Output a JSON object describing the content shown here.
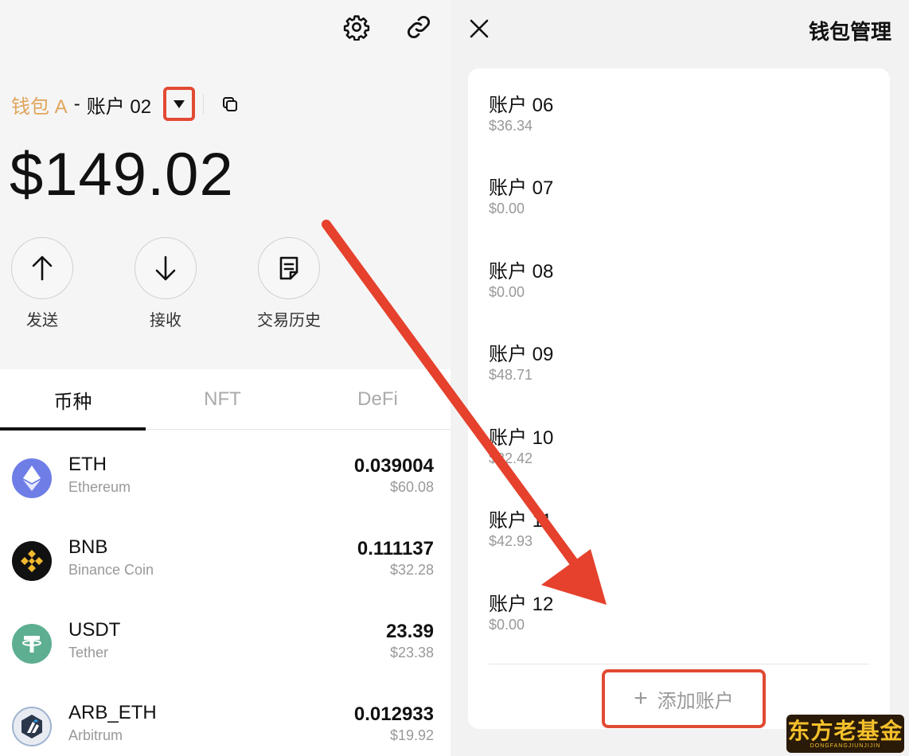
{
  "left": {
    "wallet_name": "钱包 A",
    "separator": "-",
    "account_name": "账户 02",
    "balance": "$149.02",
    "actions": [
      {
        "label": "发送",
        "icon": "arrow-up-icon"
      },
      {
        "label": "接收",
        "icon": "arrow-down-icon"
      },
      {
        "label": "交易历史",
        "icon": "history-icon"
      }
    ],
    "tabs": [
      {
        "label": "币种",
        "active": true
      },
      {
        "label": "NFT",
        "active": false
      },
      {
        "label": "DeFi",
        "active": false
      }
    ],
    "tokens": [
      {
        "symbol": "ETH",
        "name": "Ethereum",
        "amount": "0.039004",
        "usd": "$60.08",
        "icon": "ethereum-icon",
        "color": "#6f7ee6"
      },
      {
        "symbol": "BNB",
        "name": "Binance Coin",
        "amount": "0.111137",
        "usd": "$32.28",
        "icon": "bnb-icon",
        "color": "#111111"
      },
      {
        "symbol": "USDT",
        "name": "Tether",
        "amount": "23.39",
        "usd": "$23.38",
        "icon": "tether-icon",
        "color": "#5eaf91"
      },
      {
        "symbol": "ARB_ETH",
        "name": "Arbitrum",
        "amount": "0.012933",
        "usd": "$19.92",
        "icon": "arbitrum-icon",
        "color": "#2c374b"
      }
    ]
  },
  "right": {
    "title": "钱包管理",
    "accounts": [
      {
        "name": "账户 06",
        "balance": "$36.34"
      },
      {
        "name": "账户 07",
        "balance": "$0.00"
      },
      {
        "name": "账户 08",
        "balance": "$0.00"
      },
      {
        "name": "账户 09",
        "balance": "$48.71"
      },
      {
        "name": "账户 10",
        "balance": "$22.42"
      },
      {
        "name": "账户 11",
        "balance": "$42.93"
      },
      {
        "name": "账户 12",
        "balance": "$0.00"
      }
    ],
    "add_account_label": "添加账户"
  },
  "watermark": {
    "main": "东方老基金",
    "sub": "DONGFANGJIUNJIJIN"
  },
  "colors": {
    "accent_gold": "#e0a45a",
    "highlight_red": "#e24a33",
    "muted": "#999999"
  }
}
